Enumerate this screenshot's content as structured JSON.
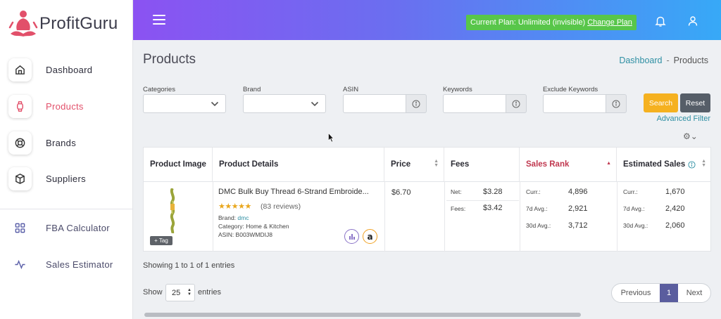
{
  "app": {
    "name": "ProfitGuru"
  },
  "sidebar": {
    "items": [
      {
        "label": "Dashboard",
        "icon": "home-icon"
      },
      {
        "label": "Products",
        "icon": "watch-icon",
        "active": true
      },
      {
        "label": "Brands",
        "icon": "lifebuoy-icon"
      },
      {
        "label": "Suppliers",
        "icon": "box-icon"
      },
      {
        "label": "FBA Calculator",
        "icon": "grid-icon"
      },
      {
        "label": "Sales Estimator",
        "icon": "activity-icon"
      }
    ]
  },
  "header": {
    "plan_text": "Current Plan: Unlimited (invisible)",
    "change_plan": "Change Plan",
    "icons": [
      "menu-icon",
      "bell-icon",
      "user-icon"
    ]
  },
  "page": {
    "title": "Products",
    "breadcrumb": {
      "home": "Dashboard",
      "separator": "-",
      "current": "Products"
    }
  },
  "filters": {
    "categories_label": "Categories",
    "brand_label": "Brand",
    "asin_label": "ASIN",
    "keywords_label": "Keywords",
    "exclude_label": "Exclude Keywords",
    "search_button": "Search",
    "reset_button": "Reset",
    "advanced": "Advanced Filter"
  },
  "table": {
    "columns": [
      "Product Image",
      "Product Details",
      "Price",
      "Fees",
      "Sales Rank",
      "Estimated Sales"
    ],
    "rows": [
      {
        "tag": "+ Tag",
        "name": "DMC Bulk Buy Thread 6-Strand Embroide...",
        "stars": "★★★★★",
        "rating": 4.5,
        "reviews": "(83 reviews)",
        "brand_label": "Brand:",
        "brand": "dmc",
        "category": "Category: Home & Kitchen",
        "asin": "ASIN: B003WMDIJ8",
        "price": "$6.70",
        "fees": {
          "net_label": "Net:",
          "net": "$3.28",
          "fees_label": "Fees:",
          "fees": "$3.42"
        },
        "sales_rank": {
          "curr_label": "Curr.:",
          "curr": "4,896",
          "avg7_label": "7d Avg.:",
          "avg7": "2,921",
          "avg30_label": "30d Avg.:",
          "avg30": "3,712"
        },
        "est_sales": {
          "curr_label": "Curr.:",
          "curr": "1,670",
          "avg7_label": "7d Avg.:",
          "avg7": "2,420",
          "avg30_label": "30d Avg.:",
          "avg30": "2,060"
        }
      }
    ]
  },
  "footer": {
    "showing": "Showing 1 to 1 of 1 entries",
    "show_label": "Show",
    "page_size": "25",
    "entries_label": "entries",
    "previous": "Previous",
    "page": "1",
    "next": "Next"
  },
  "colors": {
    "accent": "#e2506a",
    "header_start": "#8b52f2",
    "header_end": "#37a9f7",
    "plan_badge": "#58c64a",
    "search_button": "#f5b120",
    "reset_button": "#565e68",
    "link": "#2e8fa3",
    "sales_rank": "#c0384f"
  }
}
